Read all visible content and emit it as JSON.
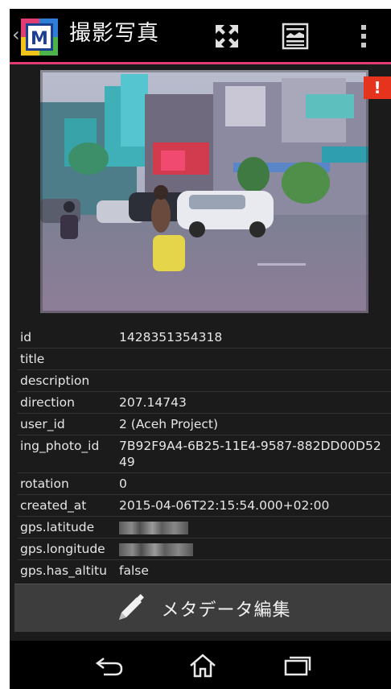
{
  "app": {
    "title": "撮影写真",
    "icon_letter": "M",
    "colors": {
      "accent": "#e23d73",
      "actionbar": "#000000",
      "background": "#1b1b1b",
      "warning": "#e5331e"
    }
  },
  "actionbar": {
    "icons": [
      "back-caret-icon",
      "app-logo-icon",
      "fullscreen-icon",
      "image-list-icon",
      "overflow-menu-icon"
    ]
  },
  "photo": {
    "warning_badge": "!"
  },
  "metadata": {
    "rows": [
      {
        "key": "id",
        "value": "1428351354318"
      },
      {
        "key": "title",
        "value": ""
      },
      {
        "key": "description",
        "value": ""
      },
      {
        "key": "direction",
        "value": "207.14743"
      },
      {
        "key": "user_id",
        "value": "2 (Aceh Project)"
      },
      {
        "key": "ing_photo_id",
        "value": "7B92F9A4-6B25-11E4-9587-882DD00D5249"
      },
      {
        "key": "rotation",
        "value": "0"
      },
      {
        "key": "created_at",
        "value": "2015-04-06T22:15:54.000+02:00"
      },
      {
        "key": "gps.latitude",
        "value": ""
      },
      {
        "key": "gps.longitude",
        "value": ""
      },
      {
        "key": "gps.has_altitu",
        "value": "false"
      }
    ]
  },
  "edit_button": {
    "label": "メタデータ編集",
    "icon": "pencil-icon"
  },
  "navbar": {
    "icons": [
      "back-icon",
      "home-icon",
      "recents-icon"
    ]
  }
}
